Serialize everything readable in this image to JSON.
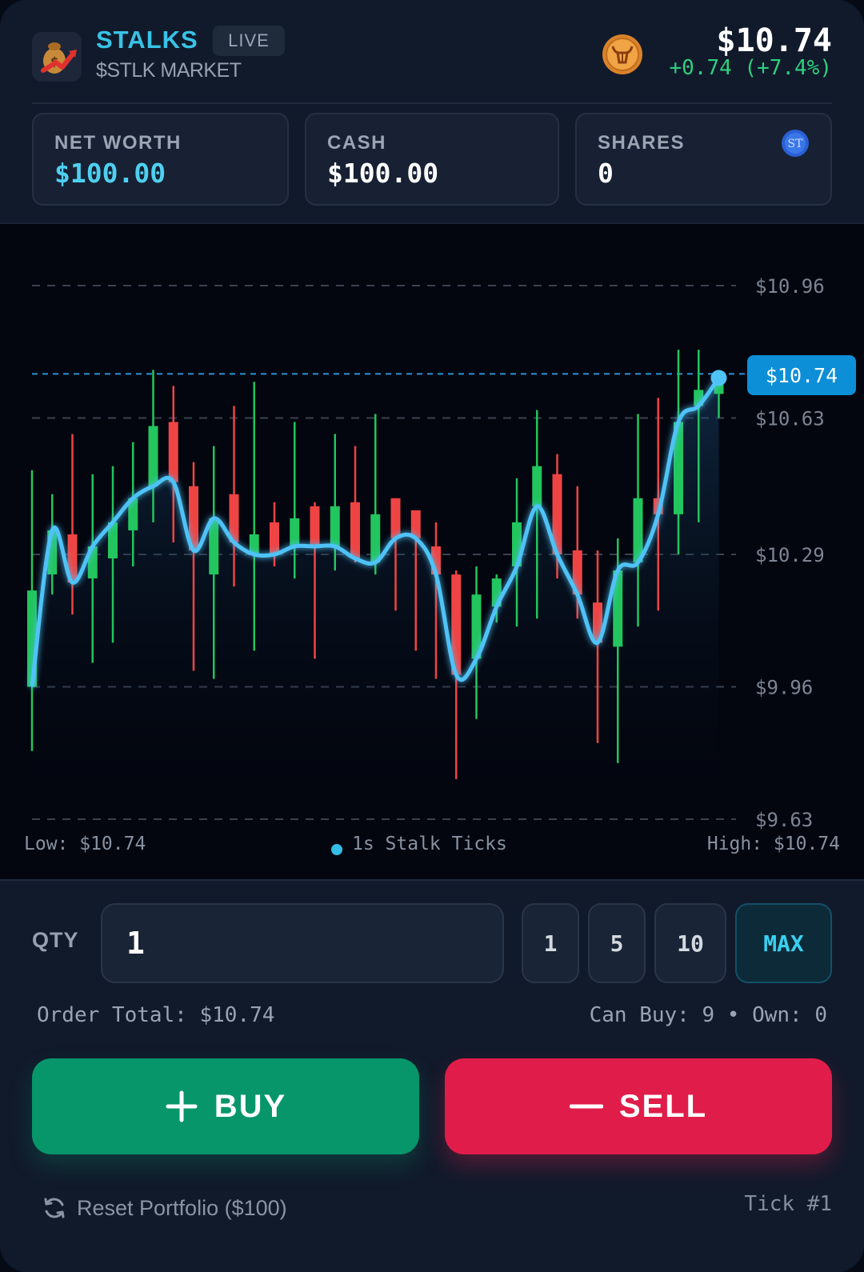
{
  "header": {
    "brand": "STALKS",
    "live_badge": "LIVE",
    "market": "$STLK MARKET",
    "price": "$10.74",
    "change": "+0.74 (+7.4%)"
  },
  "stats": {
    "net_worth_label": "NET WORTH",
    "net_worth_value": "$100.00",
    "cash_label": "CASH",
    "cash_value": "$100.00",
    "shares_label": "SHARES",
    "shares_value": "0",
    "token_icon_text": "ST"
  },
  "chart_data": {
    "type": "line",
    "price_ticks": [
      "$10.96",
      "$10.63",
      "$10.29",
      "$9.96",
      "$9.63"
    ],
    "current_price_label": "$10.74",
    "y_range": [
      9.63,
      10.96
    ],
    "current_price": 10.74,
    "candles": [
      {
        "o": 10.2,
        "c": 9.96,
        "h": 10.5,
        "l": 9.8,
        "up": true
      },
      {
        "o": 10.24,
        "c": 10.35,
        "h": 10.44,
        "l": 10.19,
        "up": true
      },
      {
        "o": 10.34,
        "c": 10.22,
        "h": 10.59,
        "l": 10.14,
        "up": false
      },
      {
        "o": 10.23,
        "c": 10.31,
        "h": 10.49,
        "l": 10.02,
        "up": true
      },
      {
        "o": 10.28,
        "c": 10.37,
        "h": 10.51,
        "l": 10.07,
        "up": true
      },
      {
        "o": 10.35,
        "c": 10.43,
        "h": 10.57,
        "l": 10.26,
        "up": true
      },
      {
        "o": 10.61,
        "c": 10.46,
        "h": 10.75,
        "l": 10.37,
        "up": true
      },
      {
        "o": 10.62,
        "c": 10.47,
        "h": 10.71,
        "l": 10.32,
        "up": false
      },
      {
        "o": 10.46,
        "c": 10.3,
        "h": 10.52,
        "l": 10.0,
        "up": false
      },
      {
        "o": 10.24,
        "c": 10.38,
        "h": 10.56,
        "l": 9.98,
        "up": true
      },
      {
        "o": 10.44,
        "c": 10.32,
        "h": 10.66,
        "l": 10.21,
        "up": false
      },
      {
        "o": 10.34,
        "c": 10.29,
        "h": 10.72,
        "l": 10.05,
        "up": true
      },
      {
        "o": 10.37,
        "c": 10.29,
        "h": 10.42,
        "l": 10.26,
        "up": false
      },
      {
        "o": 10.38,
        "c": 10.31,
        "h": 10.62,
        "l": 10.23,
        "up": true
      },
      {
        "o": 10.41,
        "c": 10.31,
        "h": 10.42,
        "l": 10.03,
        "up": false
      },
      {
        "o": 10.41,
        "c": 10.31,
        "h": 10.59,
        "l": 10.25,
        "up": true
      },
      {
        "o": 10.42,
        "c": 10.28,
        "h": 10.56,
        "l": 10.27,
        "up": false
      },
      {
        "o": 10.39,
        "c": 10.27,
        "h": 10.64,
        "l": 10.24,
        "up": true
      },
      {
        "o": 10.43,
        "c": 10.33,
        "h": 10.43,
        "l": 10.15,
        "up": false
      },
      {
        "o": 10.4,
        "c": 10.33,
        "h": 10.39,
        "l": 10.05,
        "up": false
      },
      {
        "o": 10.31,
        "c": 10.24,
        "h": 10.37,
        "l": 9.98,
        "up": false
      },
      {
        "o": 10.24,
        "c": 9.99,
        "h": 10.25,
        "l": 9.73,
        "up": false
      },
      {
        "o": 10.19,
        "c": 10.03,
        "h": 10.26,
        "l": 9.88,
        "up": true
      },
      {
        "o": 10.23,
        "c": 10.16,
        "h": 10.24,
        "l": 10.12,
        "up": true
      },
      {
        "o": 10.37,
        "c": 10.26,
        "h": 10.48,
        "l": 10.11,
        "up": true
      },
      {
        "o": 10.51,
        "c": 10.41,
        "h": 10.65,
        "l": 10.13,
        "up": true
      },
      {
        "o": 10.49,
        "c": 10.29,
        "h": 10.54,
        "l": 10.23,
        "up": false
      },
      {
        "o": 10.3,
        "c": 10.19,
        "h": 10.46,
        "l": 10.13,
        "up": false
      },
      {
        "o": 10.17,
        "c": 10.07,
        "h": 10.3,
        "l": 9.82,
        "up": false
      },
      {
        "o": 10.06,
        "c": 10.25,
        "h": 10.33,
        "l": 9.77,
        "up": true
      },
      {
        "o": 10.43,
        "c": 10.27,
        "h": 10.64,
        "l": 10.11,
        "up": true
      },
      {
        "o": 10.43,
        "c": 10.39,
        "h": 10.68,
        "l": 10.15,
        "up": false
      },
      {
        "o": 10.39,
        "c": 10.62,
        "h": 10.8,
        "l": 10.29,
        "up": true
      },
      {
        "o": 10.7,
        "c": 10.66,
        "h": 10.8,
        "l": 10.37,
        "up": true
      },
      {
        "o": 10.69,
        "c": 10.73,
        "h": 10.72,
        "l": 10.63,
        "up": true
      }
    ],
    "legend_center": "1s Stalk Ticks",
    "low_label": "Low: $10.74",
    "high_label": "High: $10.74"
  },
  "order": {
    "qty_label": "QTY",
    "qty_value": "1",
    "preset_1": "1",
    "preset_5": "5",
    "preset_10": "10",
    "preset_max": "MAX",
    "order_total": "Order Total: $10.74",
    "can_buy": "Can Buy: 9 • Own: 0",
    "buy_label": "BUY",
    "sell_label": "SELL"
  },
  "footer": {
    "reset_label": "Reset Portfolio ($100)",
    "tick": "Tick #1"
  },
  "colors": {
    "accent": "#38c3e6",
    "up": "#22c55e",
    "down": "#ef4444",
    "line": "#4fc3f7",
    "buy": "#07966a",
    "sell": "#e01d4a"
  }
}
